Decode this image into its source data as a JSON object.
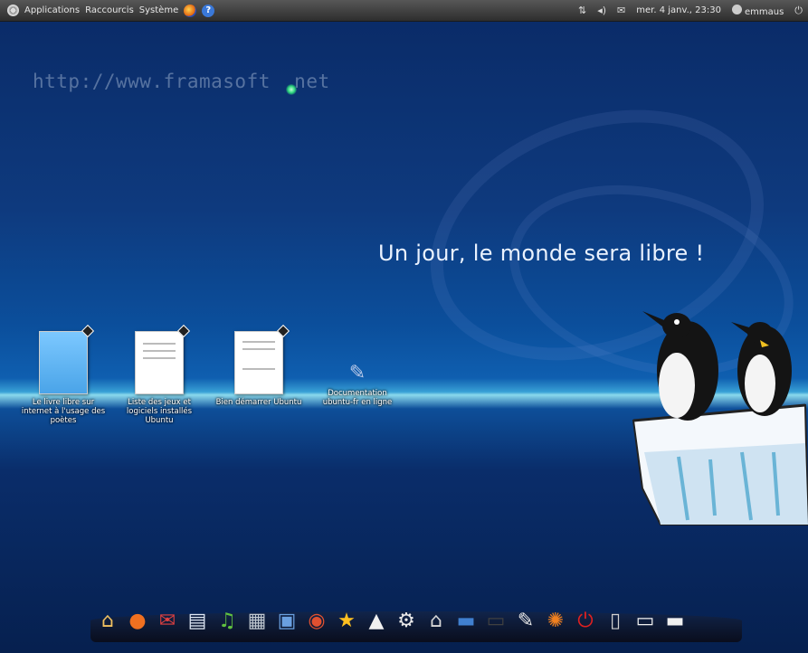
{
  "top_panel": {
    "menus": [
      "Applications",
      "Raccourcis",
      "Système"
    ],
    "datetime": "mer. 4 janv., 23:30",
    "username": "emmaus"
  },
  "wallpaper": {
    "url_text": "http://www.framasoft",
    "url_suffix": "net",
    "slogan": "Un jour, le monde sera libre !"
  },
  "desktop_icons": [
    {
      "label": "Le livre libre sur internet à l'usage des poètes"
    },
    {
      "label": "Liste des jeux et logiciels installés Ubuntu"
    },
    {
      "label": "Bien démarrer Ubuntu"
    },
    {
      "label": "Documentation ubuntu-fr en ligne"
    }
  ],
  "dock": {
    "items": [
      {
        "name": "home-icon",
        "glyph": "⌂",
        "color": "#f0c060"
      },
      {
        "name": "firefox-icon",
        "glyph": "●",
        "color": "#f07020"
      },
      {
        "name": "mail-icon",
        "glyph": "✉",
        "color": "#e04040"
      },
      {
        "name": "document-icon",
        "glyph": "▤",
        "color": "#dfe8f5"
      },
      {
        "name": "music-icon",
        "glyph": "♫",
        "color": "#60c040"
      },
      {
        "name": "video-icon",
        "glyph": "▦",
        "color": "#c0c8d0"
      },
      {
        "name": "photos-icon",
        "glyph": "▣",
        "color": "#6aa0e0"
      },
      {
        "name": "media-player-icon",
        "glyph": "◉",
        "color": "#e05030"
      },
      {
        "name": "favorites-icon",
        "glyph": "★",
        "color": "#ffc020"
      },
      {
        "name": "linux-icon",
        "glyph": "▲",
        "color": "#f0f0f0"
      },
      {
        "name": "settings-icon",
        "glyph": "⚙",
        "color": "#e8e8e8"
      },
      {
        "name": "house-icon",
        "glyph": "⌂",
        "color": "#d8d8d8"
      },
      {
        "name": "workspace-icon",
        "glyph": "▬",
        "color": "#4080d0"
      },
      {
        "name": "terminal-icon",
        "glyph": "▭",
        "color": "#404040"
      },
      {
        "name": "text-editor-icon",
        "glyph": "✎",
        "color": "#e8e8e8"
      },
      {
        "name": "ubuntu-icon",
        "glyph": "✺",
        "color": "#f08020"
      },
      {
        "name": "power-icon",
        "glyph": "⏻",
        "color": "#e02020"
      },
      {
        "name": "trash-icon",
        "glyph": "▯",
        "color": "#d0d0d0"
      },
      {
        "name": "window-icon",
        "glyph": "▭",
        "color": "#f0f0f0"
      },
      {
        "name": "minimized-window-icon",
        "glyph": "▬",
        "color": "#f0f0f0"
      }
    ]
  }
}
